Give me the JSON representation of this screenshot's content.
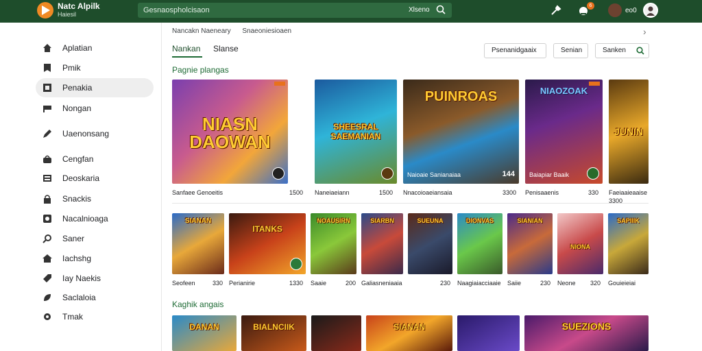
{
  "app": {
    "name": "Natc Alpilk",
    "subtitle": "Haiesil"
  },
  "search": {
    "placeholder": "Gesnaospholcisaon",
    "shortcut": "Xlseno"
  },
  "topbar": {
    "avatar_label": "eo0",
    "badge": "6"
  },
  "sidebar": {
    "items": [
      {
        "label": "Aplatian",
        "icon": "home-icon"
      },
      {
        "label": "Pmik",
        "icon": "bookmark-icon"
      },
      {
        "label": "Penakia",
        "icon": "square-icon",
        "active": true
      },
      {
        "label": "Nongan",
        "icon": "flag-icon"
      },
      {
        "label": "Uaenonsang",
        "icon": "edit-icon"
      },
      {
        "label": "Cengfan",
        "icon": "bag-icon"
      },
      {
        "label": "Deoskaria",
        "icon": "card-icon"
      },
      {
        "label": "Snackis",
        "icon": "lock-icon"
      },
      {
        "label": "Nacalnioaga",
        "icon": "image-icon"
      },
      {
        "label": "Saner",
        "icon": "search-icon"
      },
      {
        "label": "Iachshg",
        "icon": "house-icon"
      },
      {
        "label": "Iay Naekis",
        "icon": "tag-icon"
      },
      {
        "label": "Saclaloia",
        "icon": "leaf-icon"
      },
      {
        "label": "Tmak",
        "icon": "gear-icon"
      }
    ]
  },
  "breadcrumbs": [
    "Nancakn Naeneary",
    "Snaeoniesioaen"
  ],
  "tabs": [
    "Nankan",
    "Slanse"
  ],
  "filters": [
    "Psenanidgaaix",
    "Senian",
    "Sanken"
  ],
  "sections": {
    "popular": "Pagnie plangas",
    "ranking": "Kaghik angais"
  },
  "colors": {
    "header": "#1e4d2b",
    "accent": "#1e6b35",
    "badge": "#e8711c"
  },
  "row1": [
    {
      "art_title": "NIASN DAOWAN",
      "meta": "Sanfaee Genoeitis",
      "price": "1500",
      "overlay": ""
    },
    {
      "art_title": "SHEESRAL SAEMANIAN",
      "meta": "Naneiaeiann",
      "price": "1500",
      "overlay": ""
    },
    {
      "art_title": "PUINROAS",
      "meta": "Nnacoioaeiansaia",
      "price": "3300",
      "overlay": "Naioaie Sanianaiaa",
      "badge": "144"
    },
    {
      "art_title": "NIAOZOAK",
      "meta": "Penisaaenis",
      "price": "330",
      "overlay": "Baiapiar Baaik"
    },
    {
      "art_title": "JUNIN",
      "meta": "Faeiaaieaaise",
      "price": "3300",
      "overlay": ""
    }
  ],
  "row2": [
    {
      "art_title": "SIANAN",
      "meta": "Seofeen",
      "price": "330"
    },
    {
      "art_title": "ITANKS",
      "meta": "Perianirie",
      "price": "1330"
    },
    {
      "art_title": "NOAUSIRN",
      "meta": "Saaie",
      "price": "200"
    },
    {
      "art_title": "SIARBN",
      "meta": "Galiasneniaaia",
      "price": ""
    },
    {
      "art_title": "SUEUNA",
      "meta": "",
      "price": "230"
    },
    {
      "art_title": "DIONVAS",
      "meta": "Naagiaiacciaaie",
      "price": ""
    },
    {
      "art_title": "SIANIAN",
      "meta": "Saiie",
      "price": "230"
    },
    {
      "art_title": "NIONA",
      "meta": "Neone",
      "price": "320"
    },
    {
      "art_title": "SAPIIIK",
      "meta": "Gouieieiai",
      "price": ""
    }
  ],
  "row3": [
    {
      "art_title": "DANAN"
    },
    {
      "art_title": "BIALNCIIK"
    },
    {
      "art_title": ""
    },
    {
      "art_title": "SIANAN"
    },
    {
      "art_title": ""
    },
    {
      "art_title": "SUEZIONS"
    }
  ]
}
